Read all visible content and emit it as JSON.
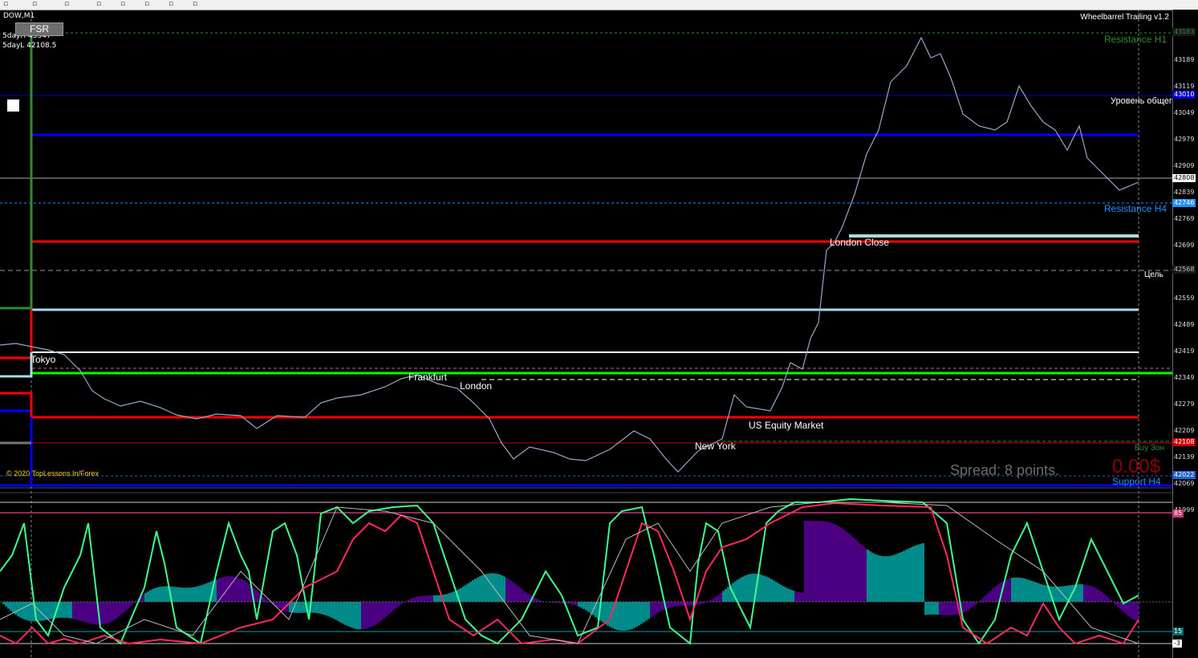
{
  "window": {
    "symbol_title": "DOW,M1",
    "ea_label": "Wheelbarrel Trailing  v1.2"
  },
  "info": {
    "day_high": "5dayH 43347",
    "day_low": "5dayL 42108.5",
    "fsr_button": "FSR"
  },
  "price_axis": {
    "ticks": [
      "43189",
      "43119",
      "43049",
      "42979",
      "42909",
      "42839",
      "42769",
      "42699",
      "42629",
      "42559",
      "42489",
      "42419",
      "42349",
      "42279",
      "42209",
      "42139",
      "42069",
      "41999"
    ],
    "tags": [
      {
        "text": "43183",
        "bg": "#1a1a1a",
        "fg": "#2e8b2e"
      },
      {
        "text": "43010",
        "bg": "#0000cc",
        "fg": "#ffffff"
      },
      {
        "text": "42808",
        "bg": "#ffffff",
        "fg": "#000000"
      },
      {
        "text": "42746",
        "bg": "#1e90ff",
        "fg": "#ffffff"
      },
      {
        "text": "42568",
        "bg": "#1a1a1a",
        "fg": "#bbbbbb"
      },
      {
        "text": "42108",
        "bg": "#cc0000",
        "fg": "#ffffff"
      },
      {
        "text": "42022",
        "bg": "#1e60d0",
        "fg": "#ffffff"
      }
    ]
  },
  "levels": {
    "resistance_h1": "Resistance H1",
    "common_level": "Уровень общег",
    "resistance_h4": "Resistance H4",
    "target": "Цель",
    "buy_zone": "Buy Зон",
    "support_h4": "Support H4"
  },
  "sessions": {
    "tokyo": "Tokyo",
    "frankfurt": "Frankfurt",
    "london": "London",
    "london_close": "London Close",
    "us_equity": "US Equity Market",
    "new_york": "New York"
  },
  "status": {
    "spread": "Spread: 8 points.",
    "profit": "0.00$",
    "copyright": "© 2020 TopLessons.In/Forex"
  },
  "indicator_axis": {
    "tags": [
      {
        "text": "85",
        "bg": "#cc3377",
        "fg": "#ffffff"
      },
      {
        "text": "15",
        "bg": "#0a6a6a",
        "fg": "#ffffff"
      },
      {
        "text": "-3",
        "bg": "#ffffff",
        "fg": "#000000"
      }
    ]
  },
  "colors": {
    "bg": "#000000",
    "resistance_h1": "#2e8b2e",
    "blue_line": "#0000ff",
    "red_line": "#ff0000",
    "lightblue_line": "#add8e6",
    "green_line": "#00ff00",
    "teal": "#008b8b",
    "purple": "#4b0082"
  }
}
